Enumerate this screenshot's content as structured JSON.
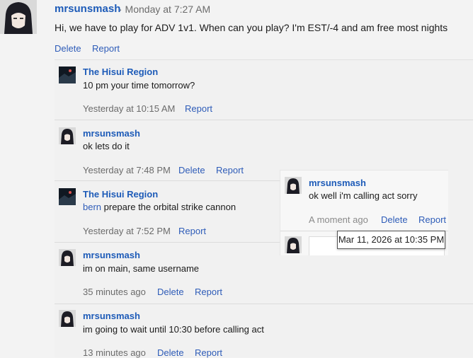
{
  "top_post": {
    "author": "mrsunsmash",
    "time": "· Monday at 7:27 AM",
    "text": "Hi, we have to play for ADV 1v1. When can you play? I'm EST/-4 and am free most nights",
    "actions": [
      "Delete",
      "Report"
    ]
  },
  "replies": [
    {
      "author": "The Hisui Region",
      "avatar": "landscape-avatar",
      "mention": "",
      "text": "10 pm your time tomorrow?",
      "time": "Yesterday at 10:15 AM",
      "actions": [
        "Report"
      ]
    },
    {
      "author": "mrsunsmash",
      "avatar": "anime-avatar",
      "mention": "",
      "text": "ok lets do it",
      "time": "Yesterday at 7:48 PM",
      "actions": [
        "Delete",
        "Report"
      ]
    },
    {
      "author": "The Hisui Region",
      "avatar": "landscape-avatar",
      "mention": "bern",
      "text": " prepare the orbital strike cannon",
      "time": "Yesterday at 7:52 PM",
      "actions": [
        "Report"
      ]
    },
    {
      "author": "mrsunsmash",
      "avatar": "anime-avatar",
      "mention": "",
      "text": "im on main, same username",
      "time": "35 minutes ago",
      "actions": [
        "Delete",
        "Report"
      ]
    },
    {
      "author": "mrsunsmash",
      "avatar": "anime-avatar",
      "mention": "",
      "text": "im going to wait until 10:30 before calling act",
      "time": "13 minutes ago",
      "actions": [
        "Delete",
        "Report"
      ]
    }
  ],
  "overlay_post": {
    "author": "mrsunsmash",
    "text": "ok well i'm calling act sorry",
    "time": "A moment ago",
    "actions": [
      "Delete",
      "Report"
    ]
  },
  "tooltip": {
    "text": "Mar 11, 2026 at 10:35 PM"
  }
}
